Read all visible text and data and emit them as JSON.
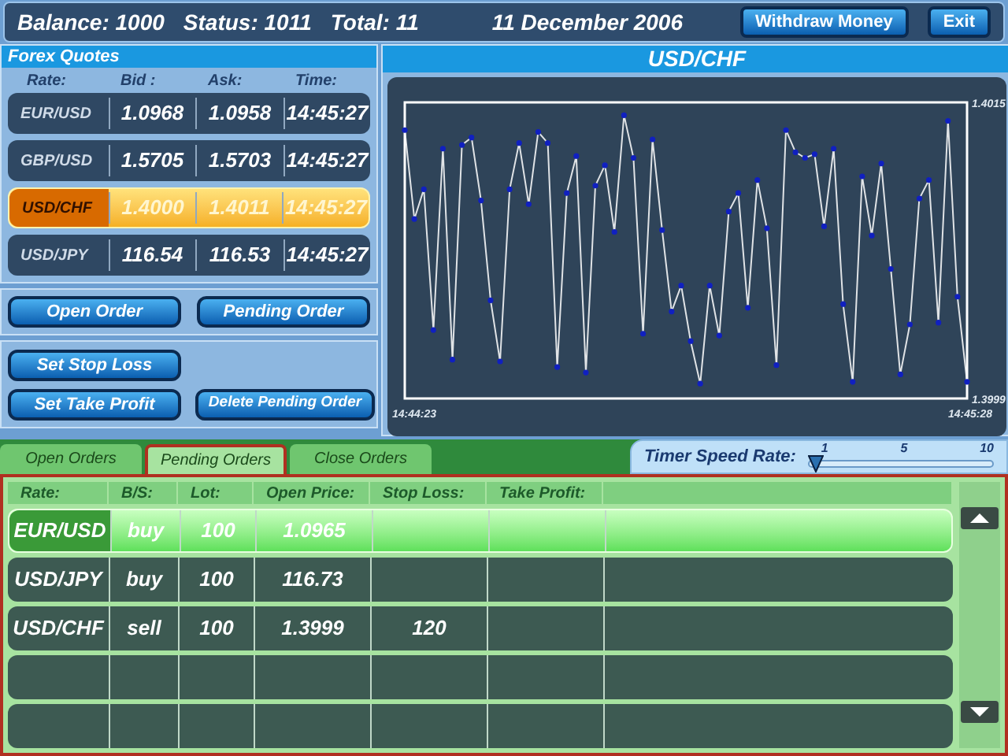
{
  "top_bar": {
    "stats": [
      "Balance: 1000",
      "Status: 1011",
      "Total: 11"
    ],
    "date": "11 December 2006",
    "buttons": [
      "Withdraw Money",
      "Exit"
    ]
  },
  "quotes": {
    "title": "Forex Quotes",
    "columns": [
      "Rate:",
      "Bid :",
      "Ask:",
      "Time:"
    ],
    "rows": [
      {
        "rate": "EUR/USD",
        "bid": "1.0968",
        "ask": "1.0958",
        "time": "14:45:27",
        "selected": false
      },
      {
        "rate": "GBP/USD",
        "bid": "1.5705",
        "ask": "1.5703",
        "time": "14:45:27",
        "selected": false
      },
      {
        "rate": "USD/CHF",
        "bid": "1.4000",
        "ask": "1.4011",
        "time": "14:45:27",
        "selected": true
      },
      {
        "rate": "USD/JPY",
        "bid": "116.54",
        "ask": "116.53",
        "time": "14:45:27",
        "selected": false
      }
    ]
  },
  "order_buttons": [
    "Open Order",
    "Pending Order"
  ],
  "action_buttons": [
    "Set Stop Loss",
    "Set Take Profit",
    "Delete Pending Order"
  ],
  "chart": {
    "start_time": "14:44:23",
    "end_time": "14:45:28",
    "chart_data": {
      "type": "line",
      "title": "USD/CHF",
      "ylim": [
        1.3999,
        1.4015
      ],
      "yticks": [
        1.4015,
        1.3999
      ],
      "series": [
        {
          "color": "#ffffff",
          "marker": "circle",
          "values": [
            1.40135,
            1.40087,
            1.40103,
            1.40027,
            1.40125,
            1.40011,
            1.40127,
            1.40131,
            1.40097,
            1.40043,
            1.4001,
            1.40103,
            1.40128,
            1.40095,
            1.40134,
            1.40128,
            1.40007,
            1.40101,
            1.40121,
            1.40004,
            1.40105,
            1.40116,
            1.4008,
            1.40143,
            1.4012,
            1.40025,
            1.4013,
            1.40081,
            1.40037,
            1.40051,
            1.40021,
            1.39998,
            1.40051,
            1.40024,
            1.40091,
            1.40101,
            1.40039,
            1.40108,
            1.40082,
            1.40008,
            1.40135,
            1.40123,
            1.4012,
            1.40122,
            1.40083,
            1.40125,
            1.40041,
            1.39999,
            1.4011,
            1.40078,
            1.40117,
            1.4006,
            1.40003,
            1.4003,
            1.40098,
            1.40108,
            1.40031,
            1.4014,
            1.40045,
            1.39999
          ]
        }
      ]
    }
  },
  "tabs": [
    {
      "label": "Open Orders",
      "selected": false
    },
    {
      "label": "Pending Orders",
      "selected": true
    },
    {
      "label": "Close Orders",
      "selected": false
    }
  ],
  "timer": {
    "label": "Timer Speed Rate:",
    "ticks": [
      "1",
      "5",
      "10"
    ],
    "level": 0
  },
  "orders": {
    "columns": [
      "Rate:",
      "B/S:",
      "Lot:",
      "Open Price:",
      "Stop Loss:",
      "Take Profit:"
    ],
    "rows": [
      {
        "rate": "EUR/USD",
        "side": "buy",
        "lot": "100",
        "open_price": "1.0965",
        "selected": true
      },
      {
        "rate": "USD/JPY",
        "side": "buy",
        "lot": "100",
        "open_price": "116.73",
        "selected": false
      },
      {
        "rate": "USD/CHF",
        "side": "sell",
        "lot": "100",
        "open_price": "1.3999",
        "stop_loss": "120",
        "selected": false
      },
      {
        "selected": false
      },
      {
        "selected": false
      }
    ]
  }
}
